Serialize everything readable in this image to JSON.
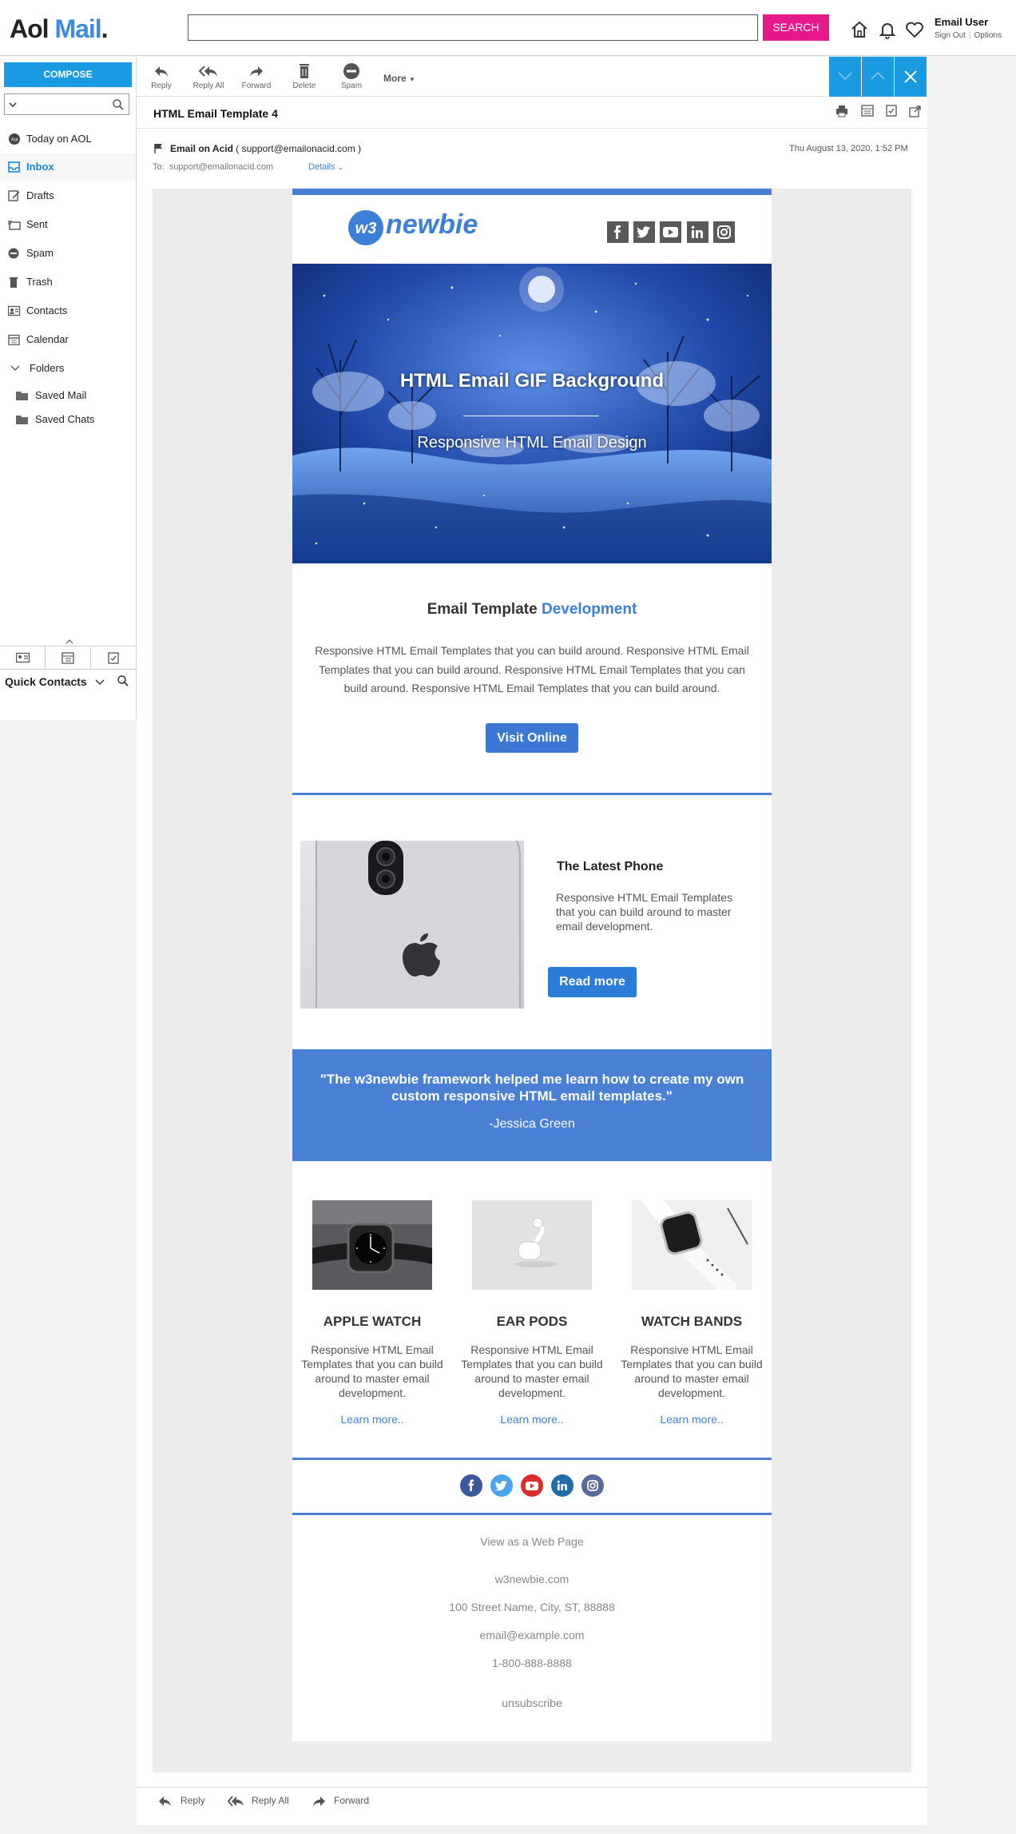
{
  "header": {
    "logo_aol": "Aol",
    "logo_mail": "Mail",
    "logo_dot": ".",
    "search_button": "SEARCH",
    "user_name": "Email User",
    "sign_out": "Sign Out",
    "options": "Options"
  },
  "sidebar": {
    "compose": "COMPOSE",
    "items": [
      {
        "label": "Today on AOL",
        "icon": "aol-icon"
      },
      {
        "label": "Inbox",
        "icon": "inbox-icon"
      },
      {
        "label": "Drafts",
        "icon": "drafts-icon"
      },
      {
        "label": "Sent",
        "icon": "sent-icon"
      },
      {
        "label": "Spam",
        "icon": "spam-icon"
      },
      {
        "label": "Trash",
        "icon": "trash-icon"
      },
      {
        "label": "Contacts",
        "icon": "contacts-icon"
      },
      {
        "label": "Calendar",
        "icon": "calendar-icon"
      }
    ],
    "folders_label": "Folders",
    "subfolders": [
      "Saved Mail",
      "Saved Chats"
    ],
    "quick_contacts": "Quick Contacts"
  },
  "toolbar": {
    "reply": "Reply",
    "reply_all": "Reply All",
    "forward": "Forward",
    "delete": "Delete",
    "spam": "Spam",
    "more": "More"
  },
  "message": {
    "subject": "HTML Email Template 4",
    "sender_name": "Email on Acid",
    "sender_email": "( support@emailonacid.com )",
    "date": "Thu August 13, 2020, 1:52 PM",
    "to_label": "To:",
    "to_email": "support@emailonacid.com",
    "details": "Details"
  },
  "email": {
    "brand_w3": "w3",
    "brand_name": "newbie",
    "social_icons": [
      "facebook-icon",
      "twitter-icon",
      "youtube-icon",
      "linkedin-icon",
      "instagram-icon"
    ],
    "hero_title": "HTML Email GIF Background",
    "hero_subtitle": "Responsive HTML Email Design",
    "section_title": "Email Template",
    "section_title_highlight": "Development",
    "section_body": "Responsive HTML Email Templates that you can build around. Responsive HTML Email Templates that you can build around. Responsive HTML Email Templates that you can build around. Responsive HTML Email Templates that you can build around.",
    "visit_button": "Visit Online",
    "phone_title": "The Latest Phone",
    "phone_body": "Responsive HTML Email Templates that you can build around to master email development.",
    "read_more": "Read more",
    "quote": "\"The w3newbie framework helped me learn how to create my own custom responsive HTML email templates.\"",
    "quote_author": "-Jessica Green",
    "products": [
      {
        "title": "APPLE WATCH",
        "body": "Responsive HTML Email Templates that you can build around to master email development.",
        "link": "Learn more.."
      },
      {
        "title": "EAR PODS",
        "body": "Responsive HTML Email Templates that you can build around to master email development.",
        "link": "Learn more.."
      },
      {
        "title": "WATCH BANDS",
        "body": "Responsive HTML Email Templates that you can build around to master email development.",
        "link": "Learn more.."
      }
    ],
    "footer": {
      "view_web": "View as a Web Page",
      "site": "w3newbie.com",
      "address": "100 Street Name, City, ST, 88888",
      "email": "email@example.com",
      "phone": "1-800-888-8888",
      "unsubscribe": "unsubscribe"
    }
  },
  "bottom_bar": {
    "reply": "Reply",
    "reply_all": "Reply All",
    "forward": "Forward"
  },
  "colors": {
    "accent": "#1a9ae0",
    "search": "#e6198a",
    "email_blue": "#4a80d4"
  }
}
